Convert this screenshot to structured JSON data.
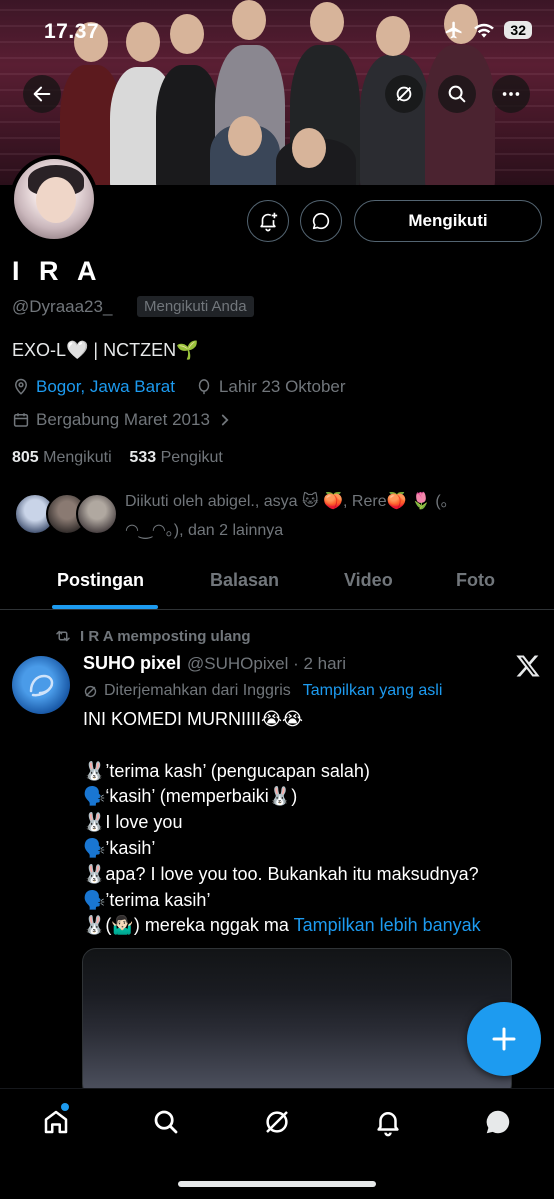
{
  "status_bar": {
    "time": "17.37",
    "battery": "32"
  },
  "profile": {
    "name": "I R A",
    "handle": "@Dyraaa23_",
    "follows_you_badge": "Mengikuti Anda",
    "follow_button": "Mengikuti",
    "bio": "EXO-L🤍 | NCTZEN🌱",
    "location": "Bogor, Jawa Barat",
    "birthday": "Lahir 23 Oktober",
    "joined": "Bergabung Maret 2013",
    "following_count": "805",
    "following_label": "Mengikuti",
    "followers_count": "533",
    "followers_label": "Pengikut",
    "followed_by_line1": "Diikuti oleh abigel., asya 🐱 🍑, Rere🍑 🌷 (。",
    "followed_by_line2": "◠‿◠。), dan 2 lainnya"
  },
  "tabs": [
    {
      "label": "Postingan",
      "active": true
    },
    {
      "label": "Balasan",
      "active": false
    },
    {
      "label": "Video",
      "active": false
    },
    {
      "label": "Foto",
      "active": false
    }
  ],
  "post": {
    "repost_label": "I R A memposting ulang",
    "author": "SUHO pixel",
    "handle_time": "@SUHOpixel · 2 hari",
    "translated_label": "Diterjemahkan dari Inggris",
    "show_original": "Tampilkan yang asli",
    "body": "INI KOMEDI MURNIIII😭😭\n\n🐰’terima kash’ (pengucapan salah)\n🗣️‘kasih’ (memperbaiki🐰)\n🐰I love you\n🗣️’kasih’\n🐰apa? I love you too. Bukankah itu maksudnya?\n🗣️’terima kasih’\n🐰(🤷🏻‍♂️) mereka nggak ma ",
    "show_more": "Tampilkan lebih banyak"
  },
  "colors": {
    "accent": "#1d9bf0",
    "background": "#000000",
    "muted": "#71767b"
  },
  "icons": [
    "back-arrow-icon",
    "grok-icon",
    "search-icon",
    "more-icon",
    "notification-bell-plus-icon",
    "message-icon",
    "location-pin-icon",
    "balloon-icon",
    "calendar-icon",
    "chevron-right-icon",
    "repost-icon",
    "x-logo-icon",
    "plus-icon",
    "home-icon",
    "explore-icon",
    "grok-nav-icon",
    "notifications-icon",
    "messages-icon"
  ]
}
